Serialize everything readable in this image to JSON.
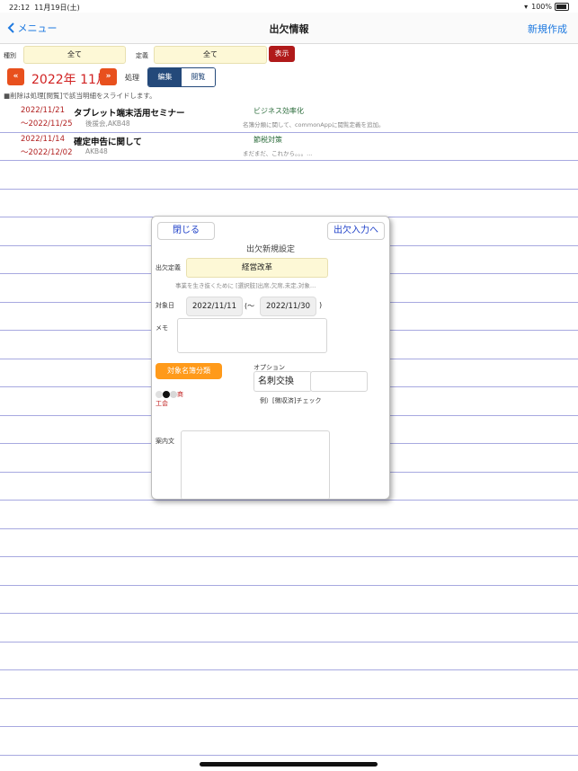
{
  "status": {
    "time": "22:12",
    "date": "11月19日(土)",
    "battery": "100%"
  },
  "nav": {
    "back_label": "メニュー",
    "title": "出欠情報",
    "create_label": "新規作成"
  },
  "filters": {
    "type_label": "種別",
    "type_value": "全て",
    "def_label": "定義",
    "def_value": "全て",
    "show_button": "表示"
  },
  "month_bar": {
    "prev": "«",
    "month": "2022年 11月",
    "next": "»",
    "process_label": "処理",
    "edit": "編集",
    "view": "閲覧"
  },
  "hint": "■削除は処理[閲覧]で該当明細をスライドします。",
  "rows": [
    {
      "start": "2022/11/21",
      "end": "～2022/11/25",
      "title": "タブレット端末活用セミナー",
      "sub": "後援会,AKB48",
      "category": "ビジネス効率化",
      "note": "名簿分類に関して、commonAppに閲覧定義を追加。"
    },
    {
      "start": "2022/11/14",
      "end": "～2022/12/02",
      "title": "確定申告に関して",
      "sub": "AKB48",
      "category": "節税対策",
      "note": "まだまだ、これから。。。..."
    }
  ],
  "modal": {
    "close": "閉じる",
    "go_attend": "出欠入力へ",
    "title": "出欠新規設定",
    "def_label": "出欠定義",
    "def_value": "経営改革",
    "def_desc": "事業を生き抜くために [選択肢]出席,欠席,未定,対象…",
    "date_label": "対象日",
    "date_from": "2022/11/11",
    "tilde": "(～",
    "date_to": "2022/11/30",
    "paren": ")",
    "memo_label": "メモ",
    "target_button": "対象名簿分類",
    "dots_text": "商",
    "dots_text2": "工会",
    "option_label": "オプション",
    "option_value": "名刺交換",
    "option_example": "例）[徴収済]チェック",
    "guide_label": "案内文"
  }
}
